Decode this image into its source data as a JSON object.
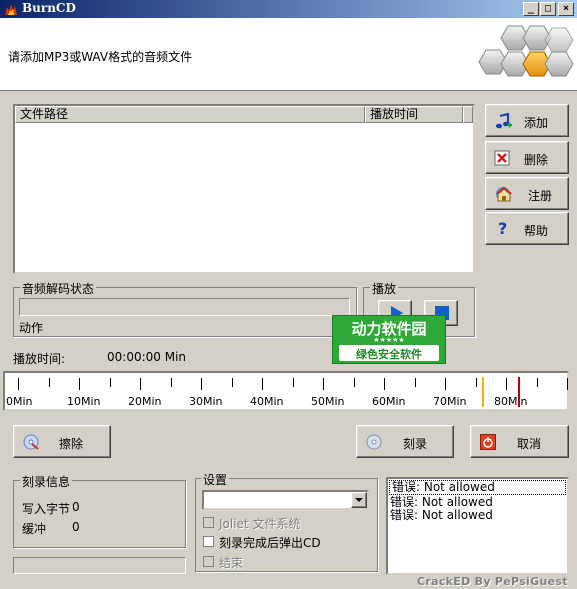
{
  "window": {
    "title": "BurnCD",
    "min": "_",
    "max": "□",
    "close": "×"
  },
  "header": {
    "text": "请添加MP3或WAV格式的音频文件"
  },
  "file_list": {
    "col_path": "文件路径",
    "col_time": "播放时间",
    "rows": []
  },
  "side_buttons": {
    "add": "添加",
    "delete": "删除",
    "register": "注册",
    "help": "帮助"
  },
  "decode": {
    "group_label": "音频解码状态",
    "action_label": "动作"
  },
  "play": {
    "group_label": "播放"
  },
  "watermark": {
    "line1": "动力软件园",
    "stars": "★★★★★",
    "line2": "绿色安全软件"
  },
  "playtime": {
    "label": "播放时间:",
    "value": "00:00:00 Min"
  },
  "ruler": {
    "labels": [
      "0Min",
      "10Min",
      "20Min",
      "30Min",
      "40Min",
      "50Min",
      "60Min",
      "70Min",
      "80Min"
    ],
    "marker_yellow_min": 76,
    "marker_red_min": 82
  },
  "actions": {
    "erase": "擦除",
    "burn": "刻录",
    "cancel": "取消"
  },
  "burn_info": {
    "group_label": "刻录信息",
    "bytes_label": "写入字节",
    "bytes_value": "0",
    "buffer_label": "缓冲",
    "buffer_value": "0"
  },
  "settings": {
    "group_label": "设置",
    "select_value": "",
    "joliet": "Joliet 文件系统",
    "eject": "刻录完成后弹出CD",
    "finish": "结束"
  },
  "log": {
    "lines": [
      "错误: Not allowed",
      "错误: Not allowed",
      "错误: Not allowed"
    ]
  },
  "credit": "CrackED By PePsiGuest",
  "colors": {
    "titlebar_start": "#0a246a",
    "watermark_green": "#2ea836",
    "marker_yellow": "#f0b400",
    "marker_red": "#c00000"
  }
}
